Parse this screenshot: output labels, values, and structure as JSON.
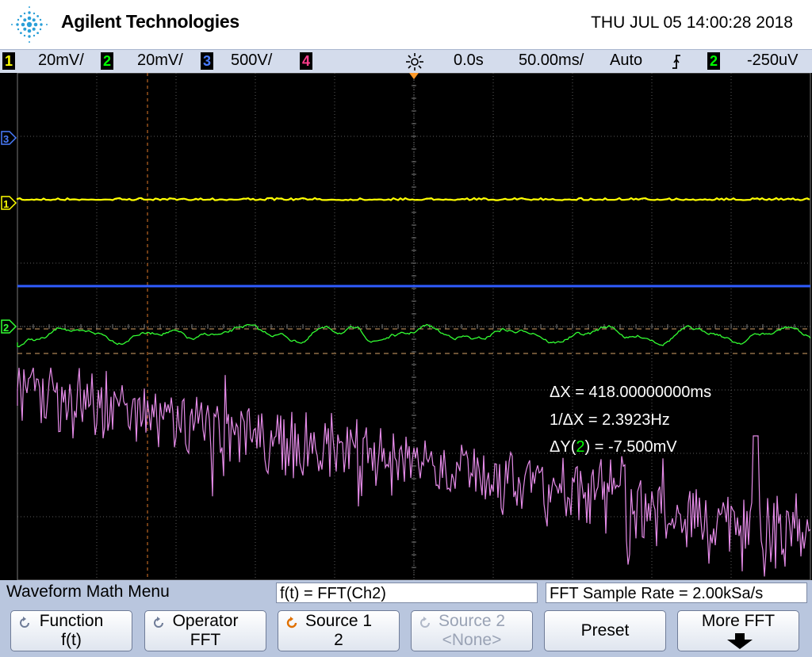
{
  "header": {
    "brand": "Agilent Technologies",
    "datetime": "THU JUL 05 14:00:28 2018"
  },
  "statusbar": {
    "ch1": {
      "num": "1",
      "scale": "20mV/",
      "color": "#ffff00"
    },
    "ch2": {
      "num": "2",
      "scale": "20mV/",
      "color": "#00ff00"
    },
    "ch3": {
      "num": "3",
      "scale": "500V/",
      "color": "#4a7dff"
    },
    "ch4": {
      "num": "4",
      "color": "#ff3c8c"
    },
    "time_delay": "0.0s",
    "timebase": "50.00ms/",
    "trigger_mode": "Auto",
    "trigger_source": "2",
    "trigger_level": "-250uV"
  },
  "screen": {
    "markers": {
      "ch1": "1",
      "ch2": "2",
      "ch3": "3"
    },
    "readouts": {
      "dx_label": "ΔX = 418.00000000ms",
      "inv_label": "1/ΔX = 2.3923Hz",
      "dy_prefix": "ΔY(",
      "dy_channel": "2",
      "dy_suffix": ") = -7.500mV"
    }
  },
  "menu": {
    "title": "Waveform Math Menu",
    "formula": "f(t) = FFT(Ch2)",
    "sample_rate": "FFT Sample Rate = 2.00kSa/s",
    "softkeys": {
      "function": {
        "line1": "Function",
        "line2": "f(t)"
      },
      "operator": {
        "line1": "Operator",
        "line2": "FFT"
      },
      "source1": {
        "line1": "Source 1",
        "line2": "2"
      },
      "source2": {
        "line1": "Source 2",
        "line2": "<None>"
      },
      "preset": {
        "label": "Preset"
      },
      "more_fft": {
        "label": "More FFT"
      }
    }
  }
}
